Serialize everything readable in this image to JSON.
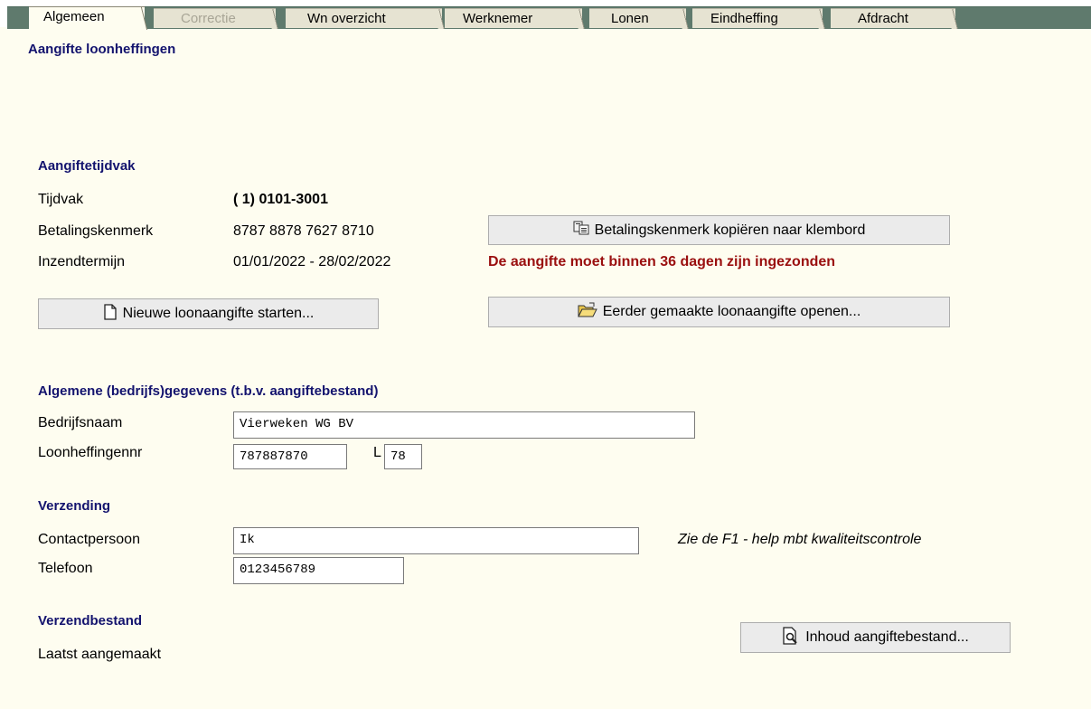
{
  "tabs": [
    {
      "label": "Algemeen",
      "state": "active"
    },
    {
      "label": "Correctie",
      "state": "disabled"
    },
    {
      "label": "Wn overzicht",
      "state": "normal"
    },
    {
      "label": "Werknemer",
      "state": "normal"
    },
    {
      "label": "Lonen",
      "state": "normal"
    },
    {
      "label": "Eindheffing",
      "state": "normal"
    },
    {
      "label": "Afdracht",
      "state": "normal"
    }
  ],
  "page_title": "Aangifte loonheffingen",
  "tijdvak_section": {
    "heading": "Aangiftetijdvak",
    "tijdvak_label": "Tijdvak",
    "tijdvak_value": "( 1) 0101-3001",
    "betalingskenmerk_label": "Betalingskenmerk",
    "betalingskenmerk_value": "8787 8878 7627 8710",
    "inzendtermijn_label": "Inzendtermijn",
    "inzendtermijn_value": "01/01/2022 - 28/02/2022",
    "warning": "De aangifte moet binnen 36 dagen zijn ingezonden"
  },
  "buttons": {
    "copy_kenmerk": "Betalingskenmerk kopiëren naar klembord",
    "new_aangifte": "Nieuwe loonaangifte starten...",
    "open_aangifte": "Eerder gemaakte loonaangifte openen...",
    "inhoud": "Inhoud aangiftebestand..."
  },
  "bedrijf_section": {
    "heading": "Algemene (bedrijfs)gegevens (t.b.v. aangiftebestand)",
    "bedrijfsnaam_label": "Bedrijfsnaam",
    "bedrijfsnaam_value": "Vierweken WG BV",
    "loonheffingennr_label": "Loonheffingennr",
    "loonheffingennr_value": "787887870",
    "l_label": "L",
    "l_value": "78"
  },
  "verzending_section": {
    "heading": "Verzending",
    "contactpersoon_label": "Contactpersoon",
    "contactpersoon_value": "Ik",
    "telefoon_label": "Telefoon",
    "telefoon_value": "0123456789",
    "help_note": "Zie de F1 - help mbt kwaliteitscontrole"
  },
  "verzendbestand_section": {
    "heading": "Verzendbestand",
    "laatst_label": "Laatst aangemaakt"
  },
  "icons": {
    "copy": "copy-icon",
    "new_doc": "new-document-icon",
    "open_folder": "open-folder-icon",
    "preview": "preview-document-icon"
  },
  "colors": {
    "section_heading": "#13136e",
    "warning": "#9a0f0f",
    "background": "#fefdf0",
    "tabstrip": "#5f7a6d"
  }
}
